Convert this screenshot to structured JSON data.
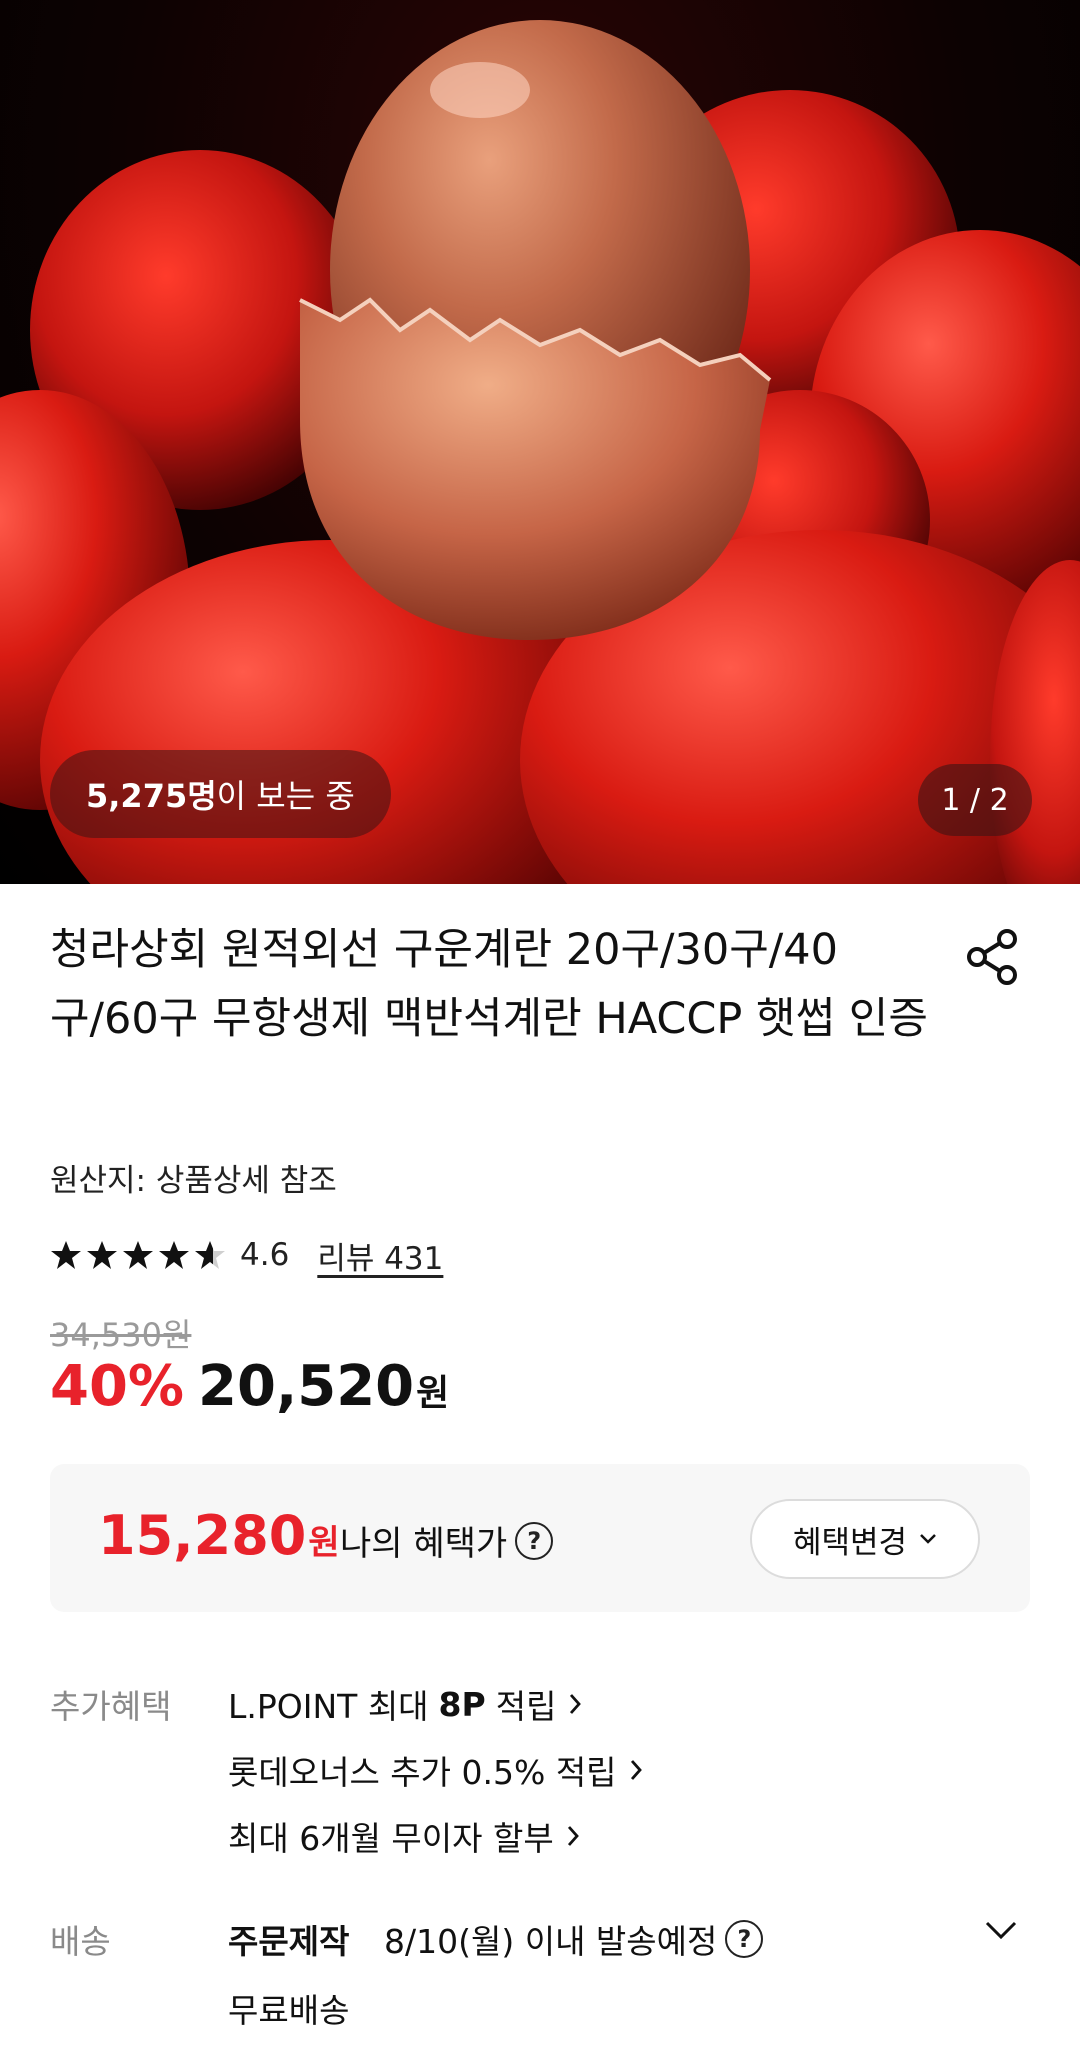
{
  "hero": {
    "viewer_count": "5,275명",
    "viewer_suffix": "이 보는 중",
    "page_indicator": "1 / 2"
  },
  "product": {
    "title": "청라상회 원적외선 구운계란 20구/30구/40구/60구 무항생제 맥반석계란 HACCP 햇썹 인증",
    "origin": "원산지: 상품상세 참조",
    "rating": "4.6",
    "rating_stars": 4.6,
    "review_label": "리뷰 431",
    "original_price": "34,530원",
    "discount": "40%",
    "price": "20,520",
    "price_unit": "원"
  },
  "benefit": {
    "price": "15,280",
    "price_unit": "원",
    "label": "나의 혜택가",
    "help": "?",
    "change_button": "혜택변경"
  },
  "extra_benefits": {
    "label": "추가혜택",
    "items": [
      {
        "prefix": "L.POINT 최대",
        "bold": "8P",
        "suffix": "적립"
      },
      {
        "text": "롯데오너스 추가 0.5% 적립"
      },
      {
        "text": "최대 6개월 무이자 할부"
      }
    ]
  },
  "delivery": {
    "label": "배송",
    "method": "주문제작",
    "date": "8/10(월) 이내 발송예정",
    "help": "?",
    "fee": "무료배송"
  },
  "colors": {
    "accent": "#e8222b",
    "text": "#111111",
    "muted": "#8a8a8a"
  }
}
